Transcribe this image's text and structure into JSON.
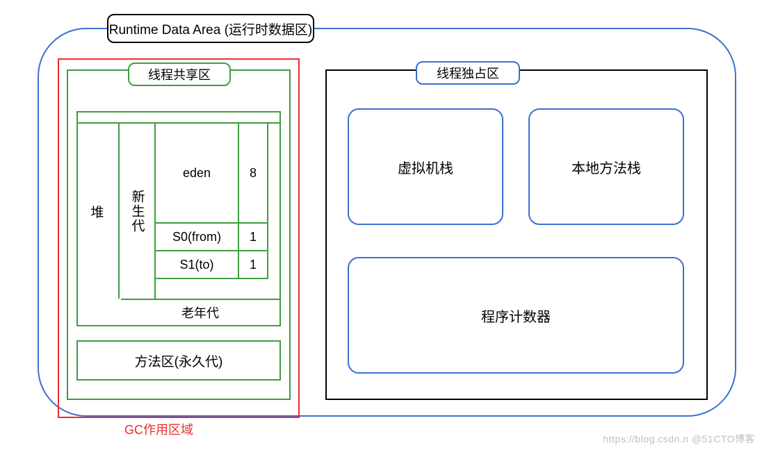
{
  "header": {
    "title": "Runtime Data Area (运行时数据区)"
  },
  "gc": {
    "label": "GC作用区域"
  },
  "left": {
    "title": "线程共享区",
    "heap_label": "堆",
    "young_label": "新生代",
    "eden": "eden",
    "eden_ratio": "8",
    "s0": "S0(from)",
    "s0_ratio": "1",
    "s1": "S1(to)",
    "s1_ratio": "1",
    "old": "老年代",
    "method_area": "方法区(永久代)"
  },
  "right": {
    "title": "线程独占区",
    "vm_stack": "虚拟机栈",
    "native_stack": "本地方法栈",
    "pc": "程序计数器"
  },
  "watermark": "https://blog.csdn.n @51CTO博客"
}
